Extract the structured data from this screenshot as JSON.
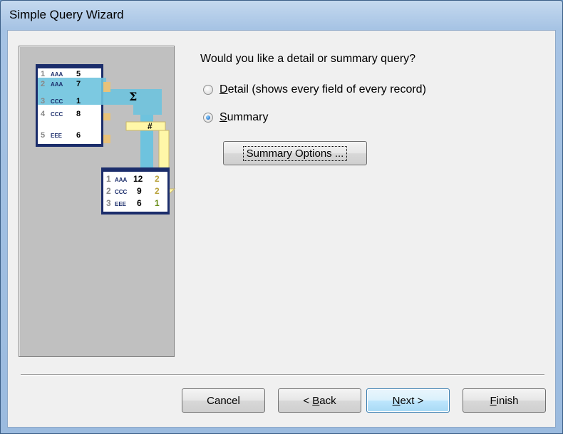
{
  "window": {
    "title": "Simple Query Wizard"
  },
  "question": "Would you like a detail or summary query?",
  "options": [
    {
      "label": "Detail (shows every field of every record)",
      "accesskey": "D",
      "checked": false
    },
    {
      "label": "Summary",
      "accesskey": "S",
      "checked": true
    }
  ],
  "summary_options_button": "Summary Options ...",
  "buttons": {
    "cancel": "Cancel",
    "back": "< Back",
    "next": "Next >",
    "finish": "Finish"
  },
  "illustration": {
    "source_rows": [
      {
        "n": "1",
        "code": "AAA",
        "val": "5"
      },
      {
        "n": "2",
        "code": "AAA",
        "val": "7"
      },
      {
        "n": "3",
        "code": "CCC",
        "val": "1"
      },
      {
        "n": "4",
        "code": "CCC",
        "val": "8"
      },
      {
        "n": "5",
        "code": "EEE",
        "val": "6"
      }
    ],
    "result_rows": [
      {
        "n": "1",
        "code": "AAA",
        "sum": "12",
        "count": "2"
      },
      {
        "n": "2",
        "code": "CCC",
        "sum": "9",
        "count": "2"
      },
      {
        "n": "3",
        "code": "EEE",
        "sum": "6",
        "count": "1"
      }
    ],
    "sum_symbol": "Σ",
    "count_symbol": "#"
  }
}
